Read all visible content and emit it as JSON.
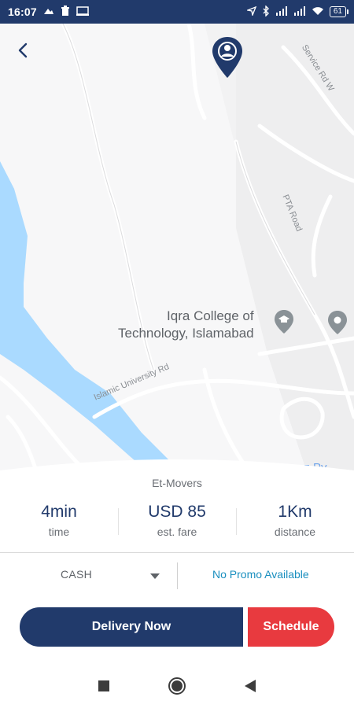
{
  "status_bar": {
    "time": "16:07",
    "battery": "61"
  },
  "map": {
    "poi_label_line1": "Iqra College of",
    "poi_label_line2": "Technology, Islamabad",
    "road_islamic_university": "Islamic University Rd",
    "road_pta": "PTA Road",
    "road_service": "Service Rd W",
    "partial_text_bottom": "Nawaz Py"
  },
  "ride": {
    "company": "Et-Movers",
    "stats": [
      {
        "value": "4min",
        "label": "time"
      },
      {
        "value": "USD 85",
        "label": "est. fare"
      },
      {
        "value": "1Km",
        "label": "distance"
      }
    ]
  },
  "payment": {
    "method": "CASH",
    "promo_text": "No Promo Available"
  },
  "actions": {
    "primary": "Delivery Now",
    "secondary": "Schedule"
  },
  "colors": {
    "primary": "#213a6b",
    "secondary": "#e83a3f",
    "promo": "#1a8fbf",
    "water": "#aadaff"
  },
  "icons": [
    "back-arrow-icon",
    "user-location-pin-icon",
    "education-poi-icon",
    "location-poi-icon",
    "dropdown-arrow-icon",
    "nav-recent-icon",
    "nav-home-icon",
    "nav-back-icon"
  ]
}
